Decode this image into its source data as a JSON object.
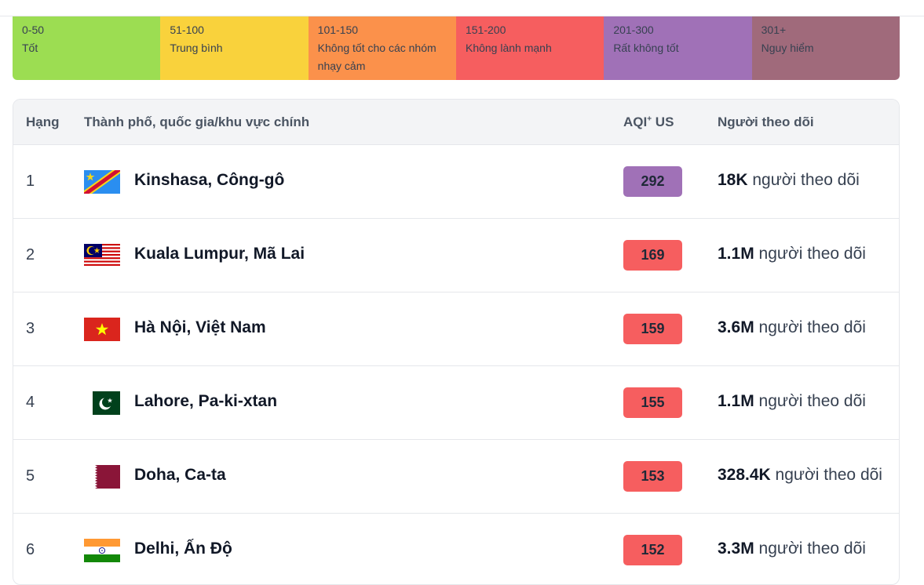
{
  "legend": [
    {
      "range": "0-50",
      "label": "Tốt",
      "color": "#9cdd52"
    },
    {
      "range": "51-100",
      "label": "Trung bình",
      "color": "#f9d23c"
    },
    {
      "range": "101-150",
      "label": "Không tốt cho các nhóm nhạy cảm",
      "color": "#fb914b"
    },
    {
      "range": "151-200",
      "label": "Không lành mạnh",
      "color": "#f65e5f"
    },
    {
      "range": "201-300",
      "label": "Rất không tốt",
      "color": "#a071b7"
    },
    {
      "range": "301+",
      "label": "Nguy hiểm",
      "color": "#a06a7b"
    }
  ],
  "table": {
    "headers": {
      "rank": "Hạng",
      "city": "Thành phố, quốc gia/khu vực chính",
      "aqi_main": "AQI",
      "aqi_sup": "+",
      "aqi_suffix": " US",
      "followers": "Người theo dõi"
    },
    "followers_suffix": " người theo dõi",
    "rows": [
      {
        "rank": "1",
        "flag": "congo-drc-flag-icon",
        "city": "Kinshasa, Công-gô",
        "aqi": "292",
        "aqi_color": "#a071b7",
        "followers": "18K"
      },
      {
        "rank": "2",
        "flag": "malaysia-flag-icon",
        "city": "Kuala Lumpur, Mã Lai",
        "aqi": "169",
        "aqi_color": "#f65e5f",
        "followers": "1.1M"
      },
      {
        "rank": "3",
        "flag": "vietnam-flag-icon",
        "city": "Hà Nội, Việt Nam",
        "aqi": "159",
        "aqi_color": "#f65e5f",
        "followers": "3.6M"
      },
      {
        "rank": "4",
        "flag": "pakistan-flag-icon",
        "city": "Lahore, Pa-ki-xtan",
        "aqi": "155",
        "aqi_color": "#f65e5f",
        "followers": "1.1M"
      },
      {
        "rank": "5",
        "flag": "qatar-flag-icon",
        "city": "Doha, Ca-ta",
        "aqi": "153",
        "aqi_color": "#f65e5f",
        "followers": "328.4K"
      },
      {
        "rank": "6",
        "flag": "india-flag-icon",
        "city": "Delhi, Ấn Độ",
        "aqi": "152",
        "aqi_color": "#f65e5f",
        "followers": "3.3M"
      }
    ]
  }
}
